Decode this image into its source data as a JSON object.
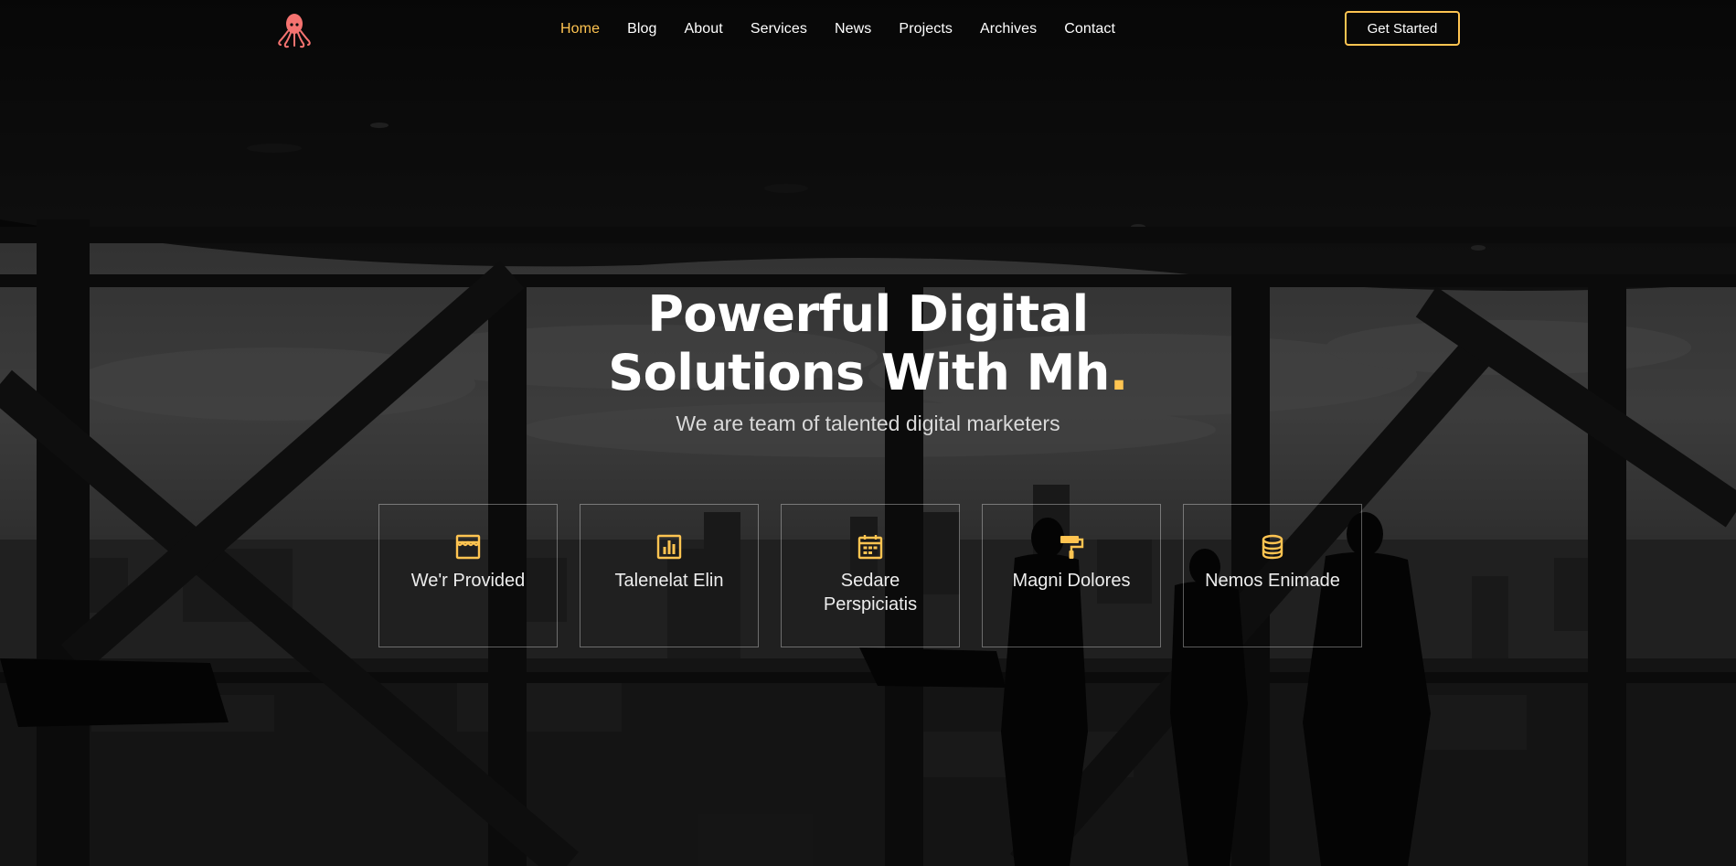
{
  "nav": {
    "items": [
      "Home",
      "Blog",
      "About",
      "Services",
      "News",
      "Projects",
      "Archives",
      "Contact"
    ],
    "active": "Home",
    "cta_label": "Get Started"
  },
  "hero": {
    "title_line1": "Powerful Digital",
    "title_line2": "Solutions With Mh",
    "title_dot": ".",
    "subtitle": "We are team of talented digital marketers"
  },
  "features": [
    {
      "icon": "store-icon",
      "label": "We'r Provided"
    },
    {
      "icon": "bar-chart-icon",
      "label": "Talenelat Elin"
    },
    {
      "icon": "calendar-icon",
      "label": "Sedare Perspiciatis"
    },
    {
      "icon": "paint-roller-icon",
      "label": "Magni Dolores"
    },
    {
      "icon": "database-icon",
      "label": "Nemos Enimade"
    }
  ],
  "colors": {
    "accent": "#ffc451",
    "logo": "#f57370",
    "background": "#0c0c0c"
  }
}
